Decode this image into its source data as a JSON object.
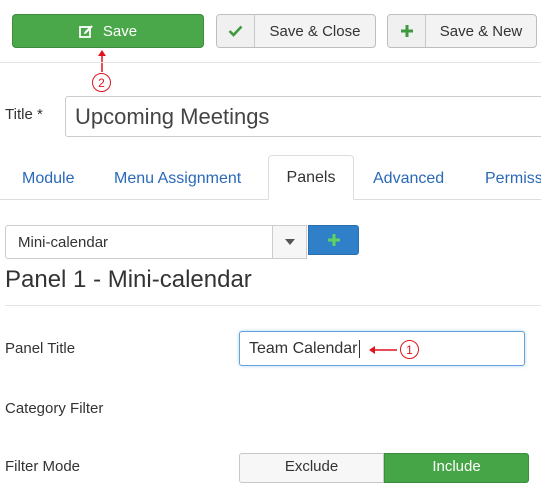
{
  "toolbar": {
    "save_label": "Save",
    "save_close_label": "Save & Close",
    "save_new_label": "Save & New"
  },
  "annotations": {
    "step_one": "1",
    "step_two": "2",
    "color": "#e0141e"
  },
  "form": {
    "title_label": "Title *",
    "title_value": "Upcoming Meetings"
  },
  "tabs": [
    {
      "label": "Module",
      "active": false
    },
    {
      "label": "Menu Assignment",
      "active": false
    },
    {
      "label": "Panels",
      "active": true
    },
    {
      "label": "Advanced",
      "active": false
    },
    {
      "label": "Permiss",
      "active": false
    }
  ],
  "panels": {
    "select_value": "Mini-calendar",
    "heading": "Panel 1 - Mini-calendar",
    "panel_title_label": "Panel Title",
    "panel_title_value": "Team Calendar",
    "category_filter_label": "Category Filter",
    "filter_mode_label": "Filter Mode",
    "filter_mode_options": [
      "Exclude",
      "Include"
    ],
    "filter_mode_selected": "Include"
  },
  "colors": {
    "save_green": "#4aa74a",
    "add_blue": "#2f80c9",
    "link_blue": "#2a69b8"
  },
  "icons": {
    "save": "edit-icon",
    "save_close": "check-icon",
    "save_new": "plus-icon",
    "add": "plus-icon",
    "dropdown": "caret-down-icon"
  }
}
